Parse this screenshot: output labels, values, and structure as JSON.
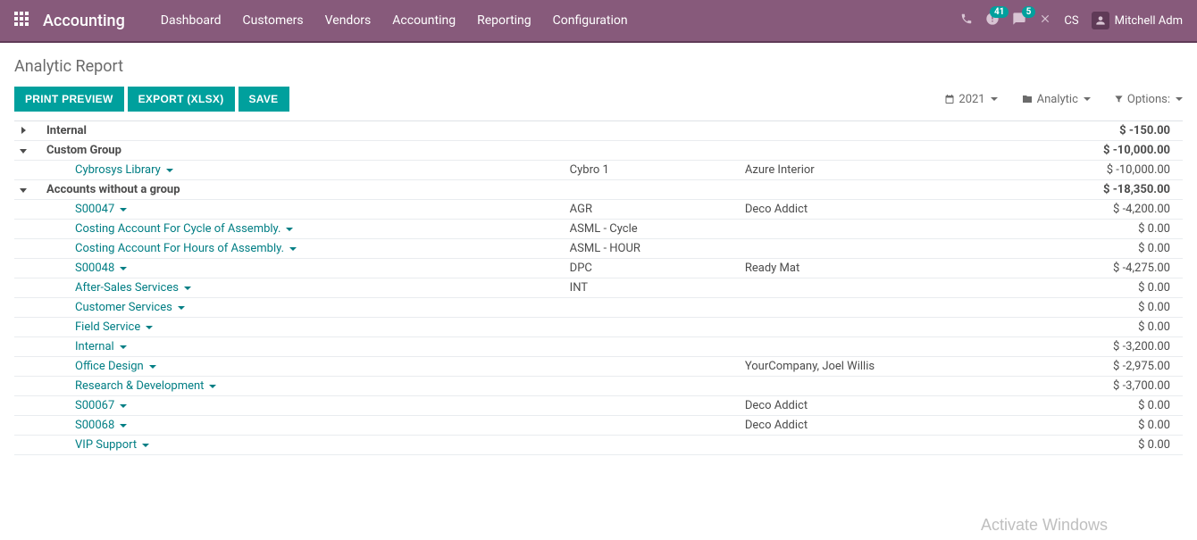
{
  "navbar": {
    "brand": "Accounting",
    "links": [
      "Dashboard",
      "Customers",
      "Vendors",
      "Accounting",
      "Reporting",
      "Configuration"
    ],
    "badge_activities": "41",
    "badge_discuss": "5",
    "company_short": "CS",
    "user_name": "Mitchell Adm"
  },
  "page_title": "Analytic Report",
  "buttons": {
    "print": "PRINT PREVIEW",
    "export": "EXPORT (XLSX)",
    "save": "SAVE"
  },
  "controls": {
    "year": "2021",
    "analytic": "Analytic",
    "options": "Options:"
  },
  "groups": [
    {
      "name": "Internal",
      "expanded": false,
      "amount": "$ -150.00",
      "rows": []
    },
    {
      "name": "Custom Group",
      "expanded": true,
      "amount": "$ -10,000.00",
      "rows": [
        {
          "name": "Cybrosys Library",
          "ref": "Cybro 1",
          "partner": "Azure Interior",
          "amount": "$ -10,000.00"
        }
      ]
    },
    {
      "name": "Accounts without a group",
      "expanded": true,
      "amount": "$ -18,350.00",
      "rows": [
        {
          "name": "S00047",
          "ref": "AGR",
          "partner": "Deco Addict",
          "amount": "$ -4,200.00"
        },
        {
          "name": "Costing Account For Cycle of Assembly.",
          "ref": "ASML - Cycle",
          "partner": "",
          "amount": "$ 0.00"
        },
        {
          "name": "Costing Account For Hours of Assembly.",
          "ref": "ASML - HOUR",
          "partner": "",
          "amount": "$ 0.00"
        },
        {
          "name": "S00048",
          "ref": "DPC",
          "partner": "Ready Mat",
          "amount": "$ -4,275.00"
        },
        {
          "name": "After-Sales Services",
          "ref": "INT",
          "partner": "",
          "amount": "$ 0.00"
        },
        {
          "name": "Customer Services",
          "ref": "",
          "partner": "",
          "amount": "$ 0.00"
        },
        {
          "name": "Field Service",
          "ref": "",
          "partner": "",
          "amount": "$ 0.00"
        },
        {
          "name": "Internal",
          "ref": "",
          "partner": "",
          "amount": "$ -3,200.00"
        },
        {
          "name": "Office Design",
          "ref": "",
          "partner": "YourCompany, Joel Willis",
          "amount": "$ -2,975.00"
        },
        {
          "name": "Research & Development",
          "ref": "",
          "partner": "",
          "amount": "$ -3,700.00"
        },
        {
          "name": "S00067",
          "ref": "",
          "partner": "Deco Addict",
          "amount": "$ 0.00"
        },
        {
          "name": "S00068",
          "ref": "",
          "partner": "Deco Addict",
          "amount": "$ 0.00"
        },
        {
          "name": "VIP Support",
          "ref": "",
          "partner": "",
          "amount": "$ 0.00"
        }
      ]
    }
  ],
  "watermark": "Activate Windows"
}
